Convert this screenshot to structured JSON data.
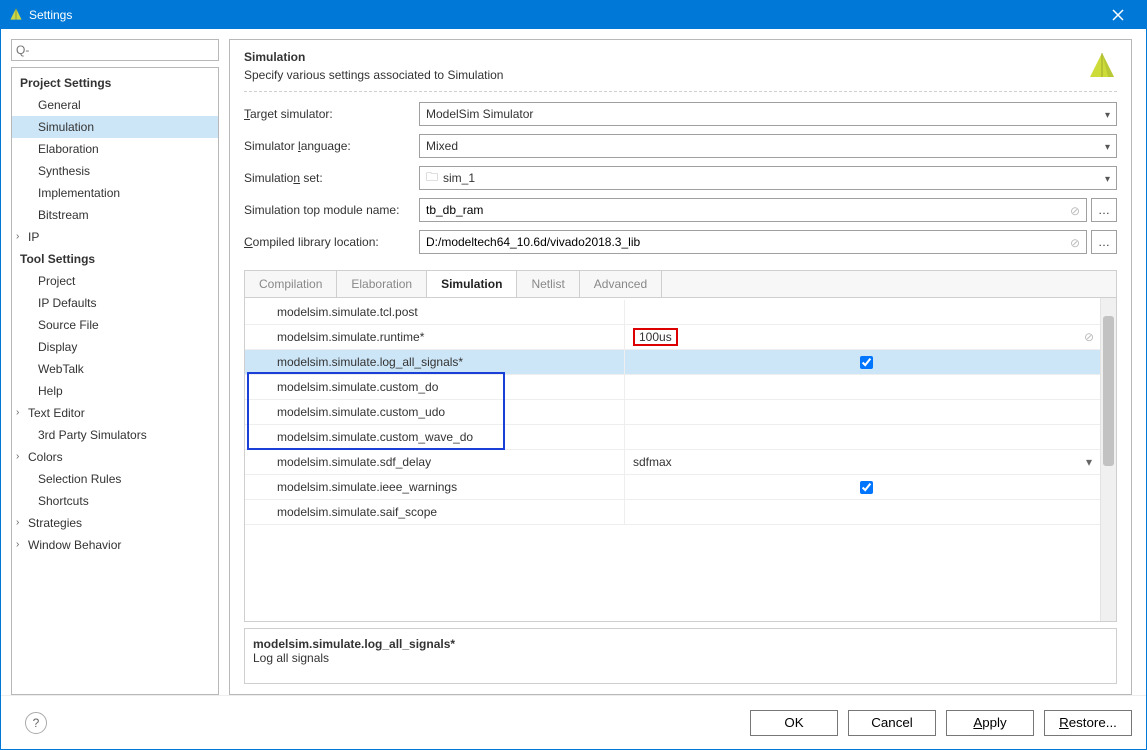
{
  "window": {
    "title": "Settings"
  },
  "search": {
    "placeholder": "Q-"
  },
  "sidebar": {
    "section1": {
      "header": "Project Settings",
      "items": [
        "General",
        "Simulation",
        "Elaboration",
        "Synthesis",
        "Implementation",
        "Bitstream",
        "IP"
      ],
      "selectedIndex": 1,
      "expandable": {
        "6": true
      }
    },
    "section2": {
      "header": "Tool Settings",
      "items": [
        "Project",
        "IP Defaults",
        "Source File",
        "Display",
        "WebTalk",
        "Help",
        "Text Editor",
        "3rd Party Simulators",
        "Colors",
        "Selection Rules",
        "Shortcuts",
        "Strategies",
        "Window Behavior"
      ],
      "expandable": {
        "6": true,
        "8": true,
        "11": true,
        "12": true
      }
    }
  },
  "main": {
    "title": "Simulation",
    "desc": "Specify various settings associated to Simulation",
    "form": {
      "target_simulator": {
        "label": "Target simulator:",
        "value": "ModelSim Simulator"
      },
      "simulator_language": {
        "label": "Simulator language:",
        "value": "Mixed"
      },
      "simulation_set": {
        "label": "Simulation set:",
        "value": "sim_1"
      },
      "top_module": {
        "label": "Simulation top module name:",
        "value": "tb_db_ram"
      },
      "lib_location": {
        "label": "Compiled library location:",
        "value": "D:/modeltech64_10.6d/vivado2018.3_lib"
      }
    },
    "tabs": [
      "Compilation",
      "Elaboration",
      "Simulation",
      "Netlist",
      "Advanced"
    ],
    "activeTab": 2,
    "grid": [
      {
        "key": "modelsim.simulate.tcl.post",
        "value": ""
      },
      {
        "key": "modelsim.simulate.runtime*",
        "value": "100us",
        "highlight": "red",
        "clearable": true
      },
      {
        "key": "modelsim.simulate.log_all_signals*",
        "value": true,
        "selected": true,
        "type": "check"
      },
      {
        "key": "modelsim.simulate.custom_do",
        "value": "",
        "highlight": "blue"
      },
      {
        "key": "modelsim.simulate.custom_udo",
        "value": "",
        "highlight": "blue"
      },
      {
        "key": "modelsim.simulate.custom_wave_do",
        "value": "",
        "highlight": "blue"
      },
      {
        "key": "modelsim.simulate.sdf_delay",
        "value": "sdfmax",
        "type": "select"
      },
      {
        "key": "modelsim.simulate.ieee_warnings",
        "value": true,
        "type": "check"
      },
      {
        "key": "modelsim.simulate.saif_scope",
        "value": ""
      }
    ],
    "desc_box": {
      "key": "modelsim.simulate.log_all_signals*",
      "text": "Log all signals"
    }
  },
  "footer": {
    "ok": "OK",
    "cancel": "Cancel",
    "apply": "Apply",
    "restore": "Restore..."
  }
}
